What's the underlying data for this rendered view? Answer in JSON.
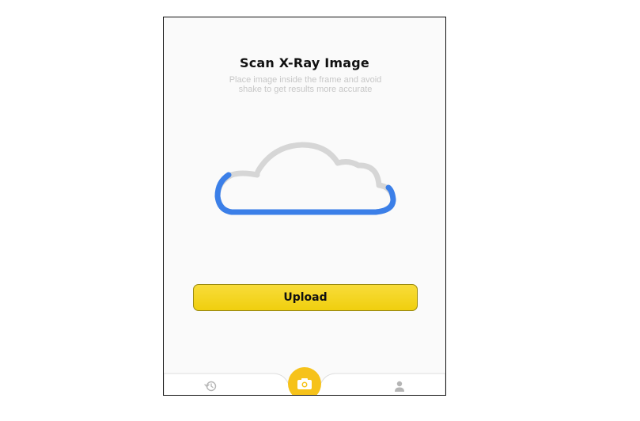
{
  "screen": {
    "title": "Scan X-Ray Image",
    "subtitle_line1": "Place image inside the frame and avoid",
    "subtitle_line2": "shake to get results more accurate"
  },
  "upload": {
    "label": "Upload",
    "progress_percent": 45
  },
  "icons": {
    "upload_graphic": "cloud-icon",
    "nav_left": "history-icon",
    "nav_center": "camera-icon",
    "nav_right": "profile-icon"
  },
  "colors": {
    "accent_yellow": "#f0cf0e",
    "camera_button": "#f6c21a",
    "progress_blue": "#3b7fe8",
    "cloud_gray": "#d6d6d6"
  }
}
